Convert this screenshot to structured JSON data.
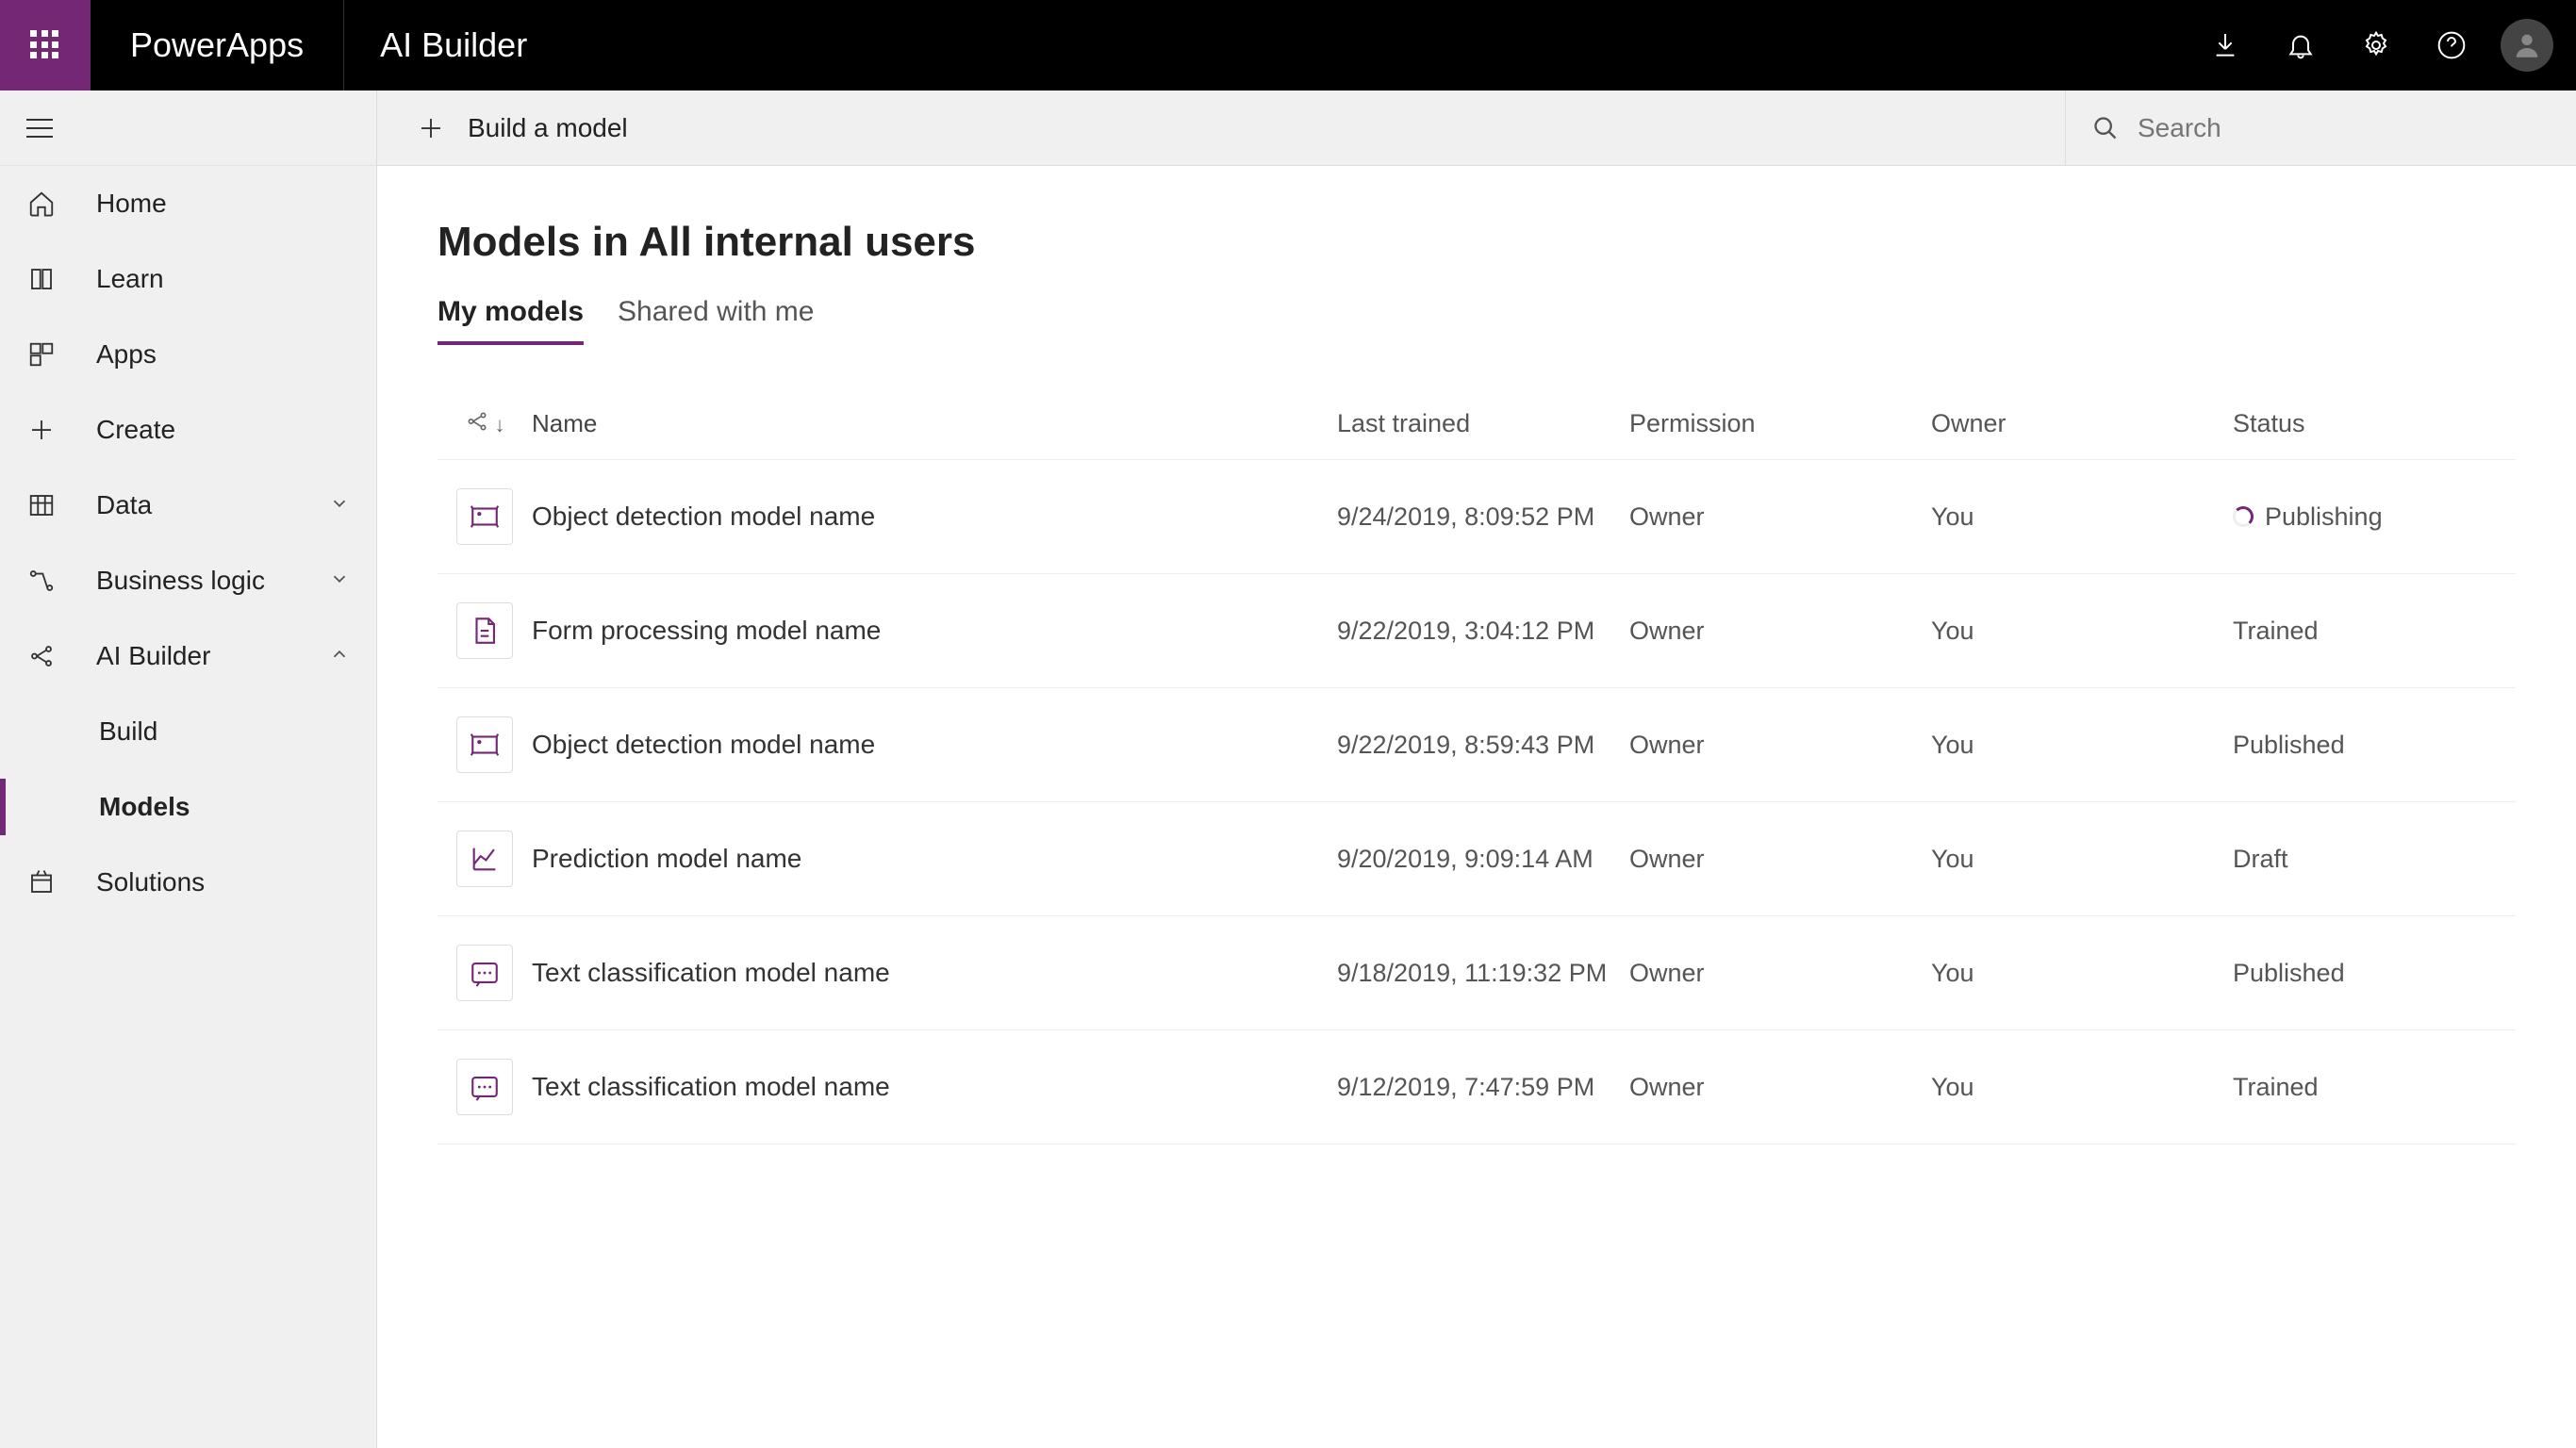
{
  "header": {
    "appName": "PowerApps",
    "pageTitle": "AI Builder"
  },
  "sidebar": {
    "items": [
      {
        "label": "Home"
      },
      {
        "label": "Learn"
      },
      {
        "label": "Apps"
      },
      {
        "label": "Create"
      },
      {
        "label": "Data"
      },
      {
        "label": "Business logic"
      },
      {
        "label": "AI Builder"
      },
      {
        "label": "Build"
      },
      {
        "label": "Models"
      },
      {
        "label": "Solutions"
      }
    ]
  },
  "commandBar": {
    "buildLabel": "Build a model",
    "searchPlaceholder": "Search"
  },
  "content": {
    "title": "Models in All internal users",
    "tabs": [
      {
        "label": "My models"
      },
      {
        "label": "Shared with me"
      }
    ],
    "columns": {
      "name": "Name",
      "lastTrained": "Last trained",
      "permission": "Permission",
      "owner": "Owner",
      "status": "Status"
    },
    "rows": [
      {
        "name": "Object detection model name",
        "lastTrained": "9/24/2019, 8:09:52 PM",
        "permission": "Owner",
        "owner": "You",
        "status": "Publishing",
        "iconType": "object"
      },
      {
        "name": "Form processing model name",
        "lastTrained": "9/22/2019, 3:04:12 PM",
        "permission": "Owner",
        "owner": "You",
        "status": "Trained",
        "iconType": "form"
      },
      {
        "name": "Object detection model name",
        "lastTrained": "9/22/2019, 8:59:43 PM",
        "permission": "Owner",
        "owner": "You",
        "status": "Published",
        "iconType": "object"
      },
      {
        "name": "Prediction model name",
        "lastTrained": "9/20/2019, 9:09:14 AM",
        "permission": "Owner",
        "owner": "You",
        "status": "Draft",
        "iconType": "prediction"
      },
      {
        "name": "Text classification model name",
        "lastTrained": "9/18/2019, 11:19:32 PM",
        "permission": "Owner",
        "owner": "You",
        "status": "Published",
        "iconType": "text"
      },
      {
        "name": "Text classification model name",
        "lastTrained": "9/12/2019, 7:47:59 PM",
        "permission": "Owner",
        "owner": "You",
        "status": "Trained",
        "iconType": "text"
      }
    ]
  }
}
